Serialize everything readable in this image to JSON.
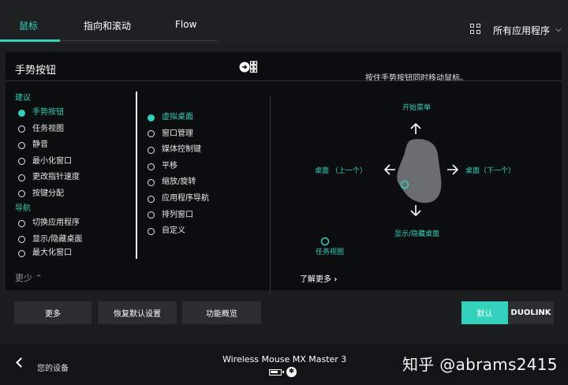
{
  "tabs": [
    {
      "label": "鼠标"
    },
    {
      "label": "指向和滚动"
    },
    {
      "label": "Flow"
    }
  ],
  "app_select": {
    "label": "所有应用程序"
  },
  "panel": {
    "title": "手势按钮",
    "hint": "按住手势按钮同时移动鼠标。"
  },
  "col1": {
    "groups": [
      {
        "label": "建议",
        "items": [
          "手势按钮",
          "任务视图",
          "静音",
          "最小化窗口",
          "更改指针速度",
          "按键分配"
        ]
      },
      {
        "label": "导航",
        "items": [
          "切换应用程序",
          "显示/隐藏桌面",
          "最大化窗口"
        ]
      }
    ],
    "selected": "手势按钮",
    "less_label": "更少"
  },
  "col2": {
    "items": [
      "虚拟桌面",
      "窗口管理",
      "媒体控制键",
      "平移",
      "缩放/旋转",
      "应用程序导航",
      "排列窗口",
      "自定义"
    ],
    "selected": "虚拟桌面"
  },
  "diagram": {
    "up": "开始菜单",
    "left": "桌面 （上一个）",
    "right": "桌面（下一个）",
    "down": "显示/隐藏桌面",
    "click": "任务视图"
  },
  "learn_more": "了解更多",
  "buttons": {
    "more": "更多",
    "restore": "恢复默认设置",
    "overview": "功能概览",
    "default": "默认",
    "duolink": "DUOLINK"
  },
  "footer": {
    "back_label": "您的设备",
    "device_name": "Wireless Mouse MX Master 3",
    "bluetooth_symbol": "✱",
    "watermark": "知乎 @abrams2415"
  },
  "colors": {
    "accent": "#33d1bb",
    "background": "#1b1d1f",
    "panel": "#0c0d0e"
  }
}
